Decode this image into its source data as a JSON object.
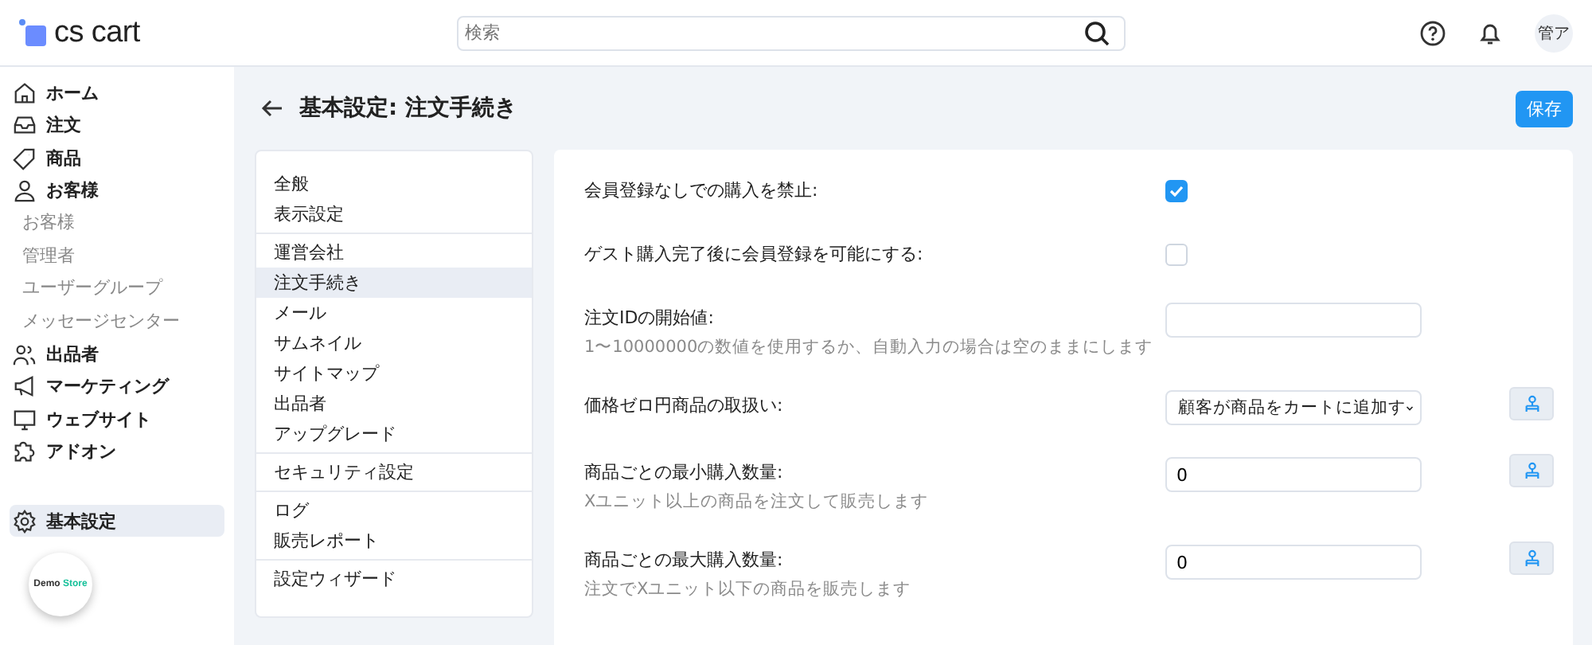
{
  "header": {
    "logo": "cs cart",
    "search": {
      "placeholder": "検索"
    },
    "avatar": "管ア"
  },
  "sidebar": {
    "items": [
      {
        "label": "ホーム",
        "selected": false
      },
      {
        "label": "注文",
        "selected": false
      },
      {
        "label": "商品",
        "selected": false
      },
      {
        "label": "お客様",
        "selected": false,
        "children": [
          {
            "label": "お客様"
          },
          {
            "label": "管理者"
          },
          {
            "label": "ユーザーグループ"
          },
          {
            "label": "メッセージセンター"
          }
        ]
      },
      {
        "label": "出品者",
        "selected": false
      },
      {
        "label": "マーケティング",
        "selected": false
      },
      {
        "label": "ウェブサイト",
        "selected": false
      },
      {
        "label": "アドオン",
        "selected": false
      }
    ],
    "bottom_item": {
      "label": "基本設定",
      "selected": true
    },
    "store_badge": {
      "part1": "Demo",
      "part2": "Store"
    }
  },
  "page": {
    "title": "基本設定: 注文手続き",
    "save_button": "保存"
  },
  "settings_nav": {
    "groups": [
      [
        {
          "label": "全般",
          "selected": false
        },
        {
          "label": "表示設定",
          "selected": false
        }
      ],
      [
        {
          "label": "運営会社",
          "selected": false
        },
        {
          "label": "注文手続き",
          "selected": true
        },
        {
          "label": "メール",
          "selected": false
        },
        {
          "label": "サムネイル",
          "selected": false
        },
        {
          "label": "サイトマップ",
          "selected": false
        },
        {
          "label": "出品者",
          "selected": false
        },
        {
          "label": "アップグレード",
          "selected": false
        }
      ],
      [
        {
          "label": "セキュリティ設定",
          "selected": false
        }
      ],
      [
        {
          "label": "ログ",
          "selected": false
        },
        {
          "label": "販売レポート",
          "selected": false
        }
      ],
      [
        {
          "label": "設定ウィザード",
          "selected": false
        }
      ]
    ]
  },
  "settings": [
    {
      "kind": "checkbox",
      "label": "会員登録なしでの購入を禁止:",
      "checked": true,
      "share": false
    },
    {
      "kind": "checkbox",
      "label": "ゲスト購入完了後に会員登録を可能にする:",
      "checked": false,
      "share": false
    },
    {
      "kind": "input",
      "label": "注文IDの開始値:",
      "hint": "1〜10000000の数値を使用するか、自動入力の場合は空のままにします",
      "share": false
    },
    {
      "kind": "select",
      "label": "価格ゼロ円商品の取扱い:",
      "value": "顧客が商品をカートに追加す",
      "share": true
    },
    {
      "kind": "input",
      "label": "商品ごとの最小購入数量:",
      "hint": "Xユニット以上の商品を注文して販売します",
      "value": "0",
      "share": true
    },
    {
      "kind": "input",
      "label": "商品ごとの最大購入数量:",
      "hint": "注文でXユニット以下の商品を販売します",
      "value": "0",
      "share": true
    }
  ]
}
